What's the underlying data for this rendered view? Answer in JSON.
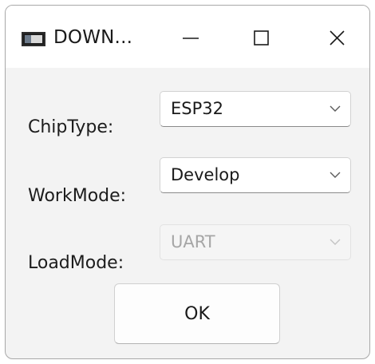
{
  "window": {
    "title": "DOWN..."
  },
  "icons": {
    "app": "app-window-icon",
    "minimize": "minimize-icon",
    "maximize": "maximize-icon",
    "close": "close-icon",
    "dropdown": "chevron-down-icon"
  },
  "form": {
    "chip_type": {
      "label": "ChipType:",
      "selected": "ESP32",
      "enabled": true
    },
    "work_mode": {
      "label": "WorkMode:",
      "selected": "Develop",
      "enabled": true
    },
    "load_mode": {
      "label": "LoadMode:",
      "selected": "UART",
      "enabled": false
    }
  },
  "actions": {
    "ok_label": "OK"
  },
  "colors": {
    "window_bg": "#f3f3f3",
    "titlebar_bg": "#ffffff",
    "disabled_text": "#a6a6a6"
  }
}
